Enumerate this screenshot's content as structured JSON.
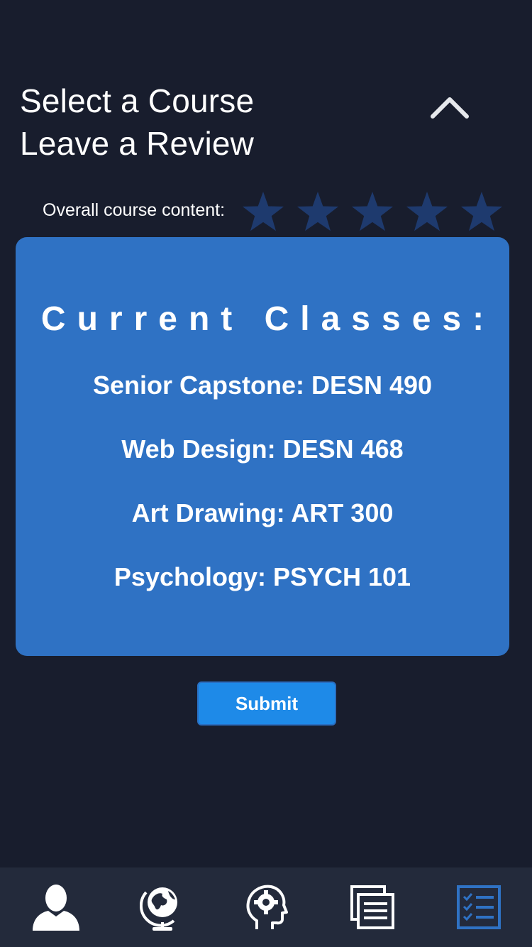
{
  "header": {
    "line1": "Select a Course",
    "line2": "Leave a Review",
    "collapse_icon": "chevron-up-icon"
  },
  "rating": {
    "label": "Overall course content:",
    "max_stars": 5,
    "selected": 0,
    "star_color": "#1e3a6e"
  },
  "classes": {
    "heading": "Current Classes:",
    "items": [
      "Senior Capstone: DESN 490",
      "Web Design: DESN 468",
      "Art Drawing: ART 300",
      "Psychology: PSYCH 101"
    ],
    "card_color": "#2f72c4"
  },
  "submit": {
    "label": "Submit",
    "color": "#1e8ae8"
  },
  "tabbar": {
    "tabs": [
      {
        "icon": "profile-icon",
        "active": false
      },
      {
        "icon": "globe-icon",
        "active": false
      },
      {
        "icon": "mind-gear-icon",
        "active": false
      },
      {
        "icon": "documents-icon",
        "active": false
      },
      {
        "icon": "checklist-icon",
        "active": true
      }
    ],
    "active_color": "#2f72c4"
  },
  "colors": {
    "background": "#181d2d",
    "tabbar": "#232a3b"
  }
}
